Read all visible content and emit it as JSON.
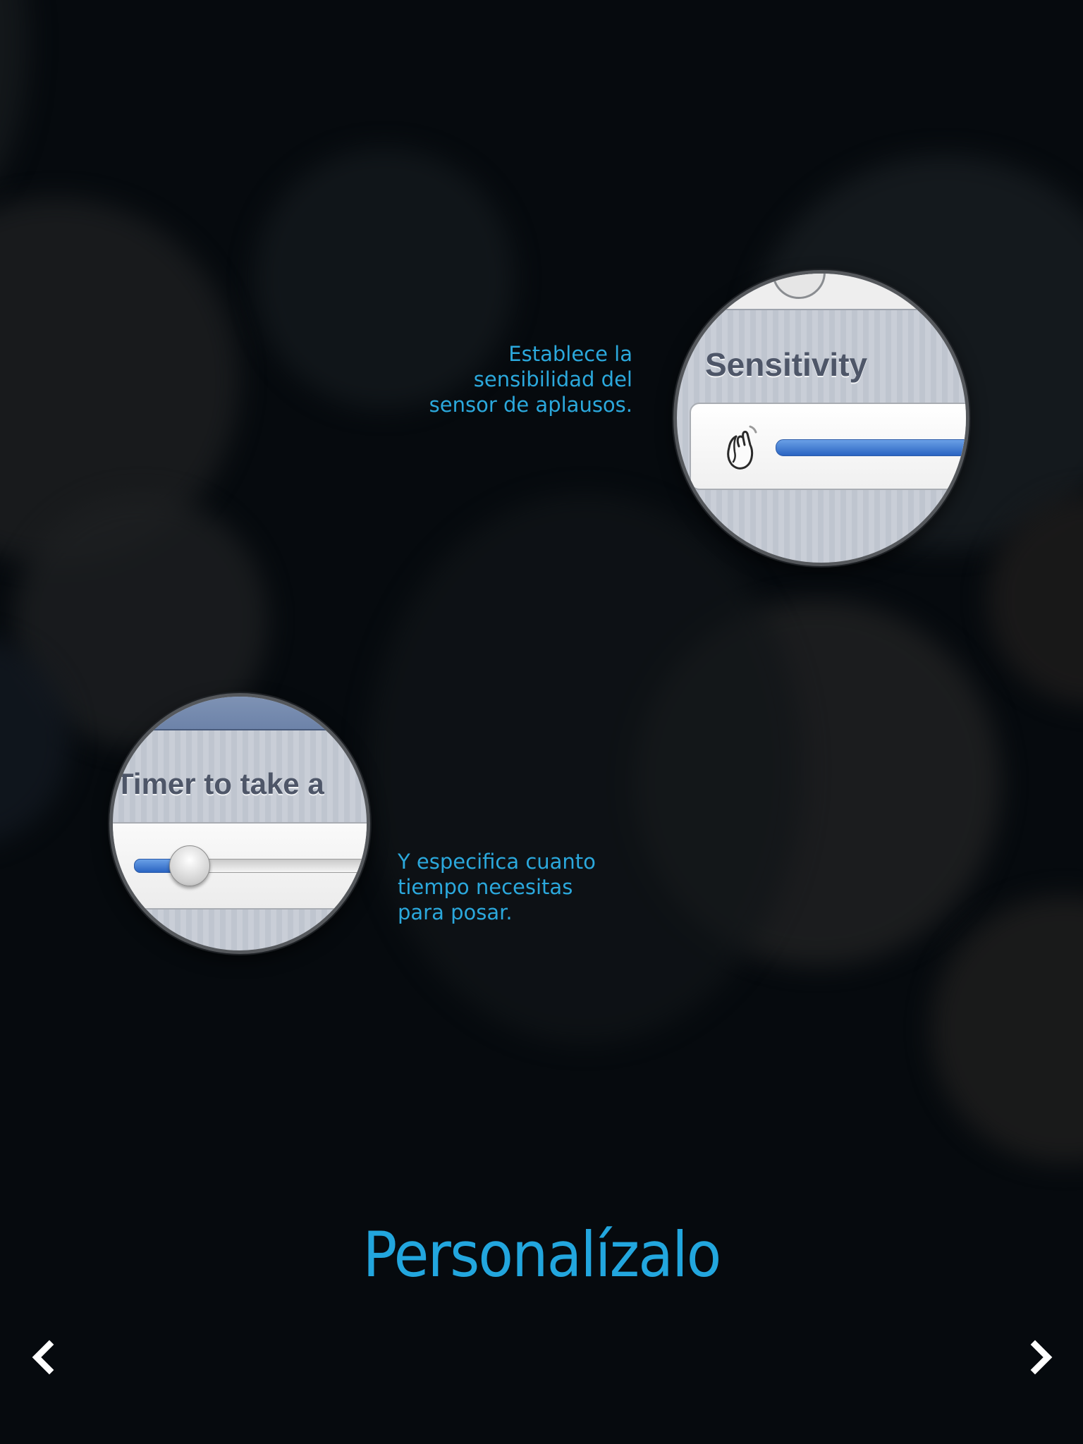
{
  "captions": {
    "sensitivity": [
      "Establece la",
      "sensibilidad del",
      "sensor de aplausos."
    ],
    "timer": [
      "Y especifica cuanto",
      "tiempo necesitas",
      "para posar."
    ]
  },
  "lens_sensitivity": {
    "heading": "Sensitivity",
    "slider_level": 1.0
  },
  "lens_timer": {
    "heading": "Timer to take a",
    "slider_level": 0.2
  },
  "page_title": "Personalízalo",
  "colors": {
    "accent": "#22a6de",
    "background": "#060a0e",
    "slider_fill": "#3a77d2"
  },
  "nav": {
    "prev_icon": "chevron-left-icon",
    "next_icon": "chevron-right-icon"
  }
}
